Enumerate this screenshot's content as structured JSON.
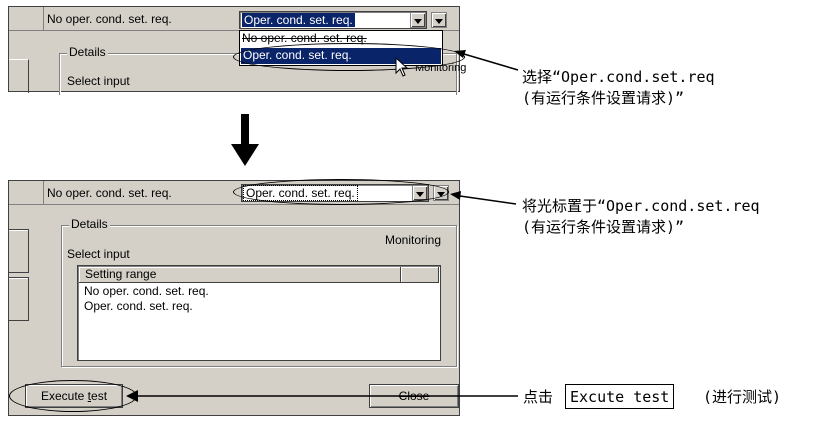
{
  "top": {
    "status_text": "No oper. cond. set. req.",
    "combo_value": "Oper. cond. set. req.",
    "dropdown_options": [
      "No oper. cond. set. req.",
      "Oper. cond. set. req."
    ],
    "details_label": "Details",
    "select_input_label": "Select input",
    "monitoring_partial": "Monitoring"
  },
  "bottom": {
    "status_text": "No oper. cond. set. req.",
    "combo_value": "Oper. cond. set. req.",
    "details_label": "Details",
    "monitoring_label": "Monitoring",
    "select_input_label": "Select input",
    "setting_range_header": "Setting range",
    "list_items": [
      "No oper. cond. set. req.",
      "Oper. cond. set. req."
    ],
    "execute_label_pre": "Execute ",
    "execute_label_underlined": "t",
    "execute_label_post": "est",
    "close_label": "Close"
  },
  "annotations": {
    "note1_line1": "选择“Oper.cond.set.req",
    "note1_line2": "(有运行条件设置请求)”",
    "note2_line1": "将光标置于“Oper.cond.set.req",
    "note2_line2": "(有运行条件设置请求)”",
    "note3_pre": "点击",
    "note3_box": "Excute test",
    "note3_post": "(进行测试)"
  }
}
